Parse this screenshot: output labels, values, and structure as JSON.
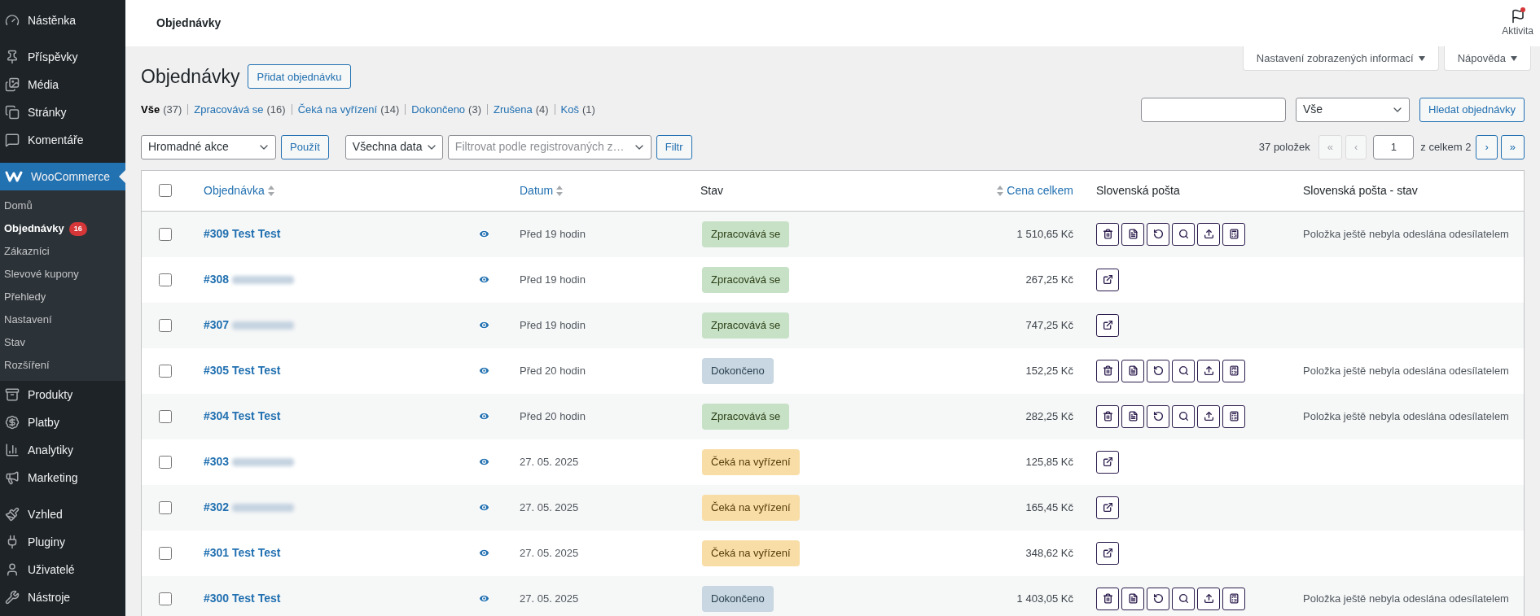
{
  "sidebar": {
    "groups": [
      {
        "items": [
          {
            "label": "Nástěnka",
            "selected": false
          }
        ]
      },
      {
        "items": [
          {
            "label": "Příspěvky",
            "selected": false
          },
          {
            "label": "Média",
            "selected": false
          },
          {
            "label": "Stránky",
            "selected": false
          },
          {
            "label": "Komentáře",
            "selected": false
          }
        ]
      },
      {
        "items": [
          {
            "label": "WooCommerce",
            "selected": true,
            "children": [
              {
                "label": "Domů",
                "selected": false
              },
              {
                "label": "Objednávky",
                "selected": true,
                "badge": "16"
              },
              {
                "label": "Zákazníci",
                "selected": false
              },
              {
                "label": "Slevové kupony",
                "selected": false
              },
              {
                "label": "Přehledy",
                "selected": false
              },
              {
                "label": "Nastavení",
                "selected": false
              },
              {
                "label": "Stav",
                "selected": false
              },
              {
                "label": "Rozšíření",
                "selected": false
              }
            ]
          },
          {
            "label": "Produkty",
            "selected": false
          },
          {
            "label": "Platby",
            "selected": false
          },
          {
            "label": "Analytiky",
            "selected": false
          },
          {
            "label": "Marketing",
            "selected": false
          }
        ]
      },
      {
        "items": [
          {
            "label": "Vzhled",
            "selected": false
          },
          {
            "label": "Pluginy",
            "selected": false
          },
          {
            "label": "Uživatelé",
            "selected": false
          },
          {
            "label": "Nástroje",
            "selected": false
          }
        ]
      }
    ]
  },
  "header": {
    "title": "Objednávky",
    "activity": "Aktivita"
  },
  "screen_tabs": [
    "Nastavení zobrazených informací",
    "Nápověda"
  ],
  "page": {
    "title": "Objednávky",
    "add_button": "Přidat objednávku"
  },
  "status_filters": [
    {
      "label": "Vše",
      "count": "(37)",
      "selected": true
    },
    {
      "label": "Zpracovává se",
      "count": "(16)",
      "selected": false
    },
    {
      "label": "Čeká na vyřízení",
      "count": "(14)",
      "selected": false
    },
    {
      "label": "Dokončeno",
      "count": "(3)",
      "selected": false
    },
    {
      "label": "Zrušena",
      "count": "(4)",
      "selected": false
    },
    {
      "label": "Koš",
      "count": "(1)",
      "selected": false
    }
  ],
  "search": {
    "status_select": "Vše",
    "button": "Hledat objednávky"
  },
  "bulk": {
    "action_select": "Hromadné akce",
    "apply": "Použít",
    "date_select": "Všechna data",
    "customer_select": "Filtrovat podle registrovaných z…",
    "filter": "Filtr"
  },
  "pagination": {
    "count": "37 položek",
    "first": {
      "label": "«",
      "disabled": true
    },
    "prev": {
      "label": "‹",
      "disabled": true
    },
    "page": "1",
    "total": "z celkem 2",
    "next": {
      "label": "›",
      "disabled": false
    },
    "last": {
      "label": "»",
      "disabled": false
    }
  },
  "table": {
    "select_all": {
      "checked": false
    },
    "columns": [
      {
        "label": "Objednávka",
        "sortable": true
      },
      {
        "label": "Datum",
        "sortable": true
      },
      {
        "label": "Stav",
        "sortable": false
      },
      {
        "label": "Cena celkem",
        "sortable": true
      },
      {
        "label": "Slovenská pošta",
        "sortable": false
      },
      {
        "label": "Slovenská pošta - stav",
        "sortable": false
      }
    ],
    "rows": [
      {
        "checked": false,
        "order": "#309 Test Test",
        "redacted": false,
        "date": "Před 19 hodin",
        "status": {
          "label": "Zpracovává se",
          "kind": "processing"
        },
        "total": "1 510,65 Kč",
        "kind": "full",
        "post_status": "Položka ještě nebyla odeslána odesílatelem"
      },
      {
        "checked": false,
        "order": "#308",
        "redacted": true,
        "date": "Před 19 hodin",
        "status": {
          "label": "Zpracovává se",
          "kind": "processing"
        },
        "total": "267,25 Kč",
        "kind": "link"
      },
      {
        "checked": false,
        "order": "#307",
        "redacted": true,
        "date": "Před 19 hodin",
        "status": {
          "label": "Zpracovává se",
          "kind": "processing"
        },
        "total": "747,25 Kč",
        "kind": "link"
      },
      {
        "checked": false,
        "order": "#305 Test Test",
        "redacted": false,
        "date": "Před 20 hodin",
        "status": {
          "label": "Dokončeno",
          "kind": "completed"
        },
        "total": "152,25 Kč",
        "kind": "full",
        "post_status": "Položka ještě nebyla odeslána odesílatelem"
      },
      {
        "checked": false,
        "order": "#304 Test Test",
        "redacted": false,
        "date": "Před 20 hodin",
        "status": {
          "label": "Zpracovává se",
          "kind": "processing"
        },
        "total": "282,25 Kč",
        "kind": "full",
        "post_status": "Položka ještě nebyla odeslána odesílatelem"
      },
      {
        "checked": false,
        "order": "#303",
        "redacted": true,
        "date": "27. 05. 2025",
        "status": {
          "label": "Čeká na vyřízení",
          "kind": "on-hold"
        },
        "total": "125,85 Kč",
        "kind": "link"
      },
      {
        "checked": false,
        "order": "#302",
        "redacted": true,
        "date": "27. 05. 2025",
        "status": {
          "label": "Čeká na vyřízení",
          "kind": "on-hold"
        },
        "total": "165,45 Kč",
        "kind": "link"
      },
      {
        "checked": false,
        "order": "#301 Test Test",
        "redacted": false,
        "date": "27. 05. 2025",
        "status": {
          "label": "Čeká na vyřízení",
          "kind": "on-hold"
        },
        "total": "348,62 Kč",
        "kind": "link"
      },
      {
        "checked": false,
        "order": "#300 Test Test",
        "redacted": false,
        "date": "27. 05. 2025",
        "status": {
          "label": "Dokončeno",
          "kind": "completed"
        },
        "total": "1 403,05 Kč",
        "kind": "full",
        "post_status": "Položka ještě nebyla odeslána odesílatelem"
      }
    ]
  }
}
